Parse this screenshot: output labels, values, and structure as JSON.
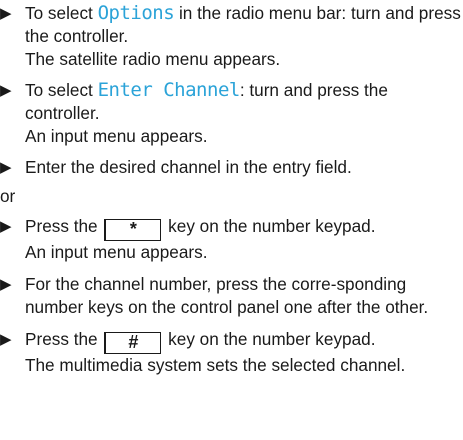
{
  "steps": {
    "s1": {
      "prefix": "To select ",
      "highlight": "Options",
      "suffix": " in the radio menu bar: turn and press the controller.",
      "result": "The satellite radio menu appears."
    },
    "s2": {
      "prefix": "To select ",
      "highlight": "Enter Channel",
      "suffix": ": turn and press the controller.",
      "result": "An input menu appears."
    },
    "s3": {
      "text": "Enter the desired channel in the entry field."
    },
    "or": "or",
    "s4": {
      "prefix": "Press the ",
      "key": "*",
      "suffix": " key on the number keypad.",
      "result": "An input menu appears."
    },
    "s5": {
      "text": "For the channel number, press the corre-sponding number keys on the control panel one after the other."
    },
    "s6": {
      "prefix": "Press the ",
      "key": "#",
      "suffix": " key on the number keypad.",
      "result": "The multimedia system sets the selected channel."
    }
  },
  "icons": {
    "bullet": "play-arrow-icon"
  },
  "colors": {
    "highlight": "#2ba3d8",
    "text": "#1a1a1a"
  }
}
